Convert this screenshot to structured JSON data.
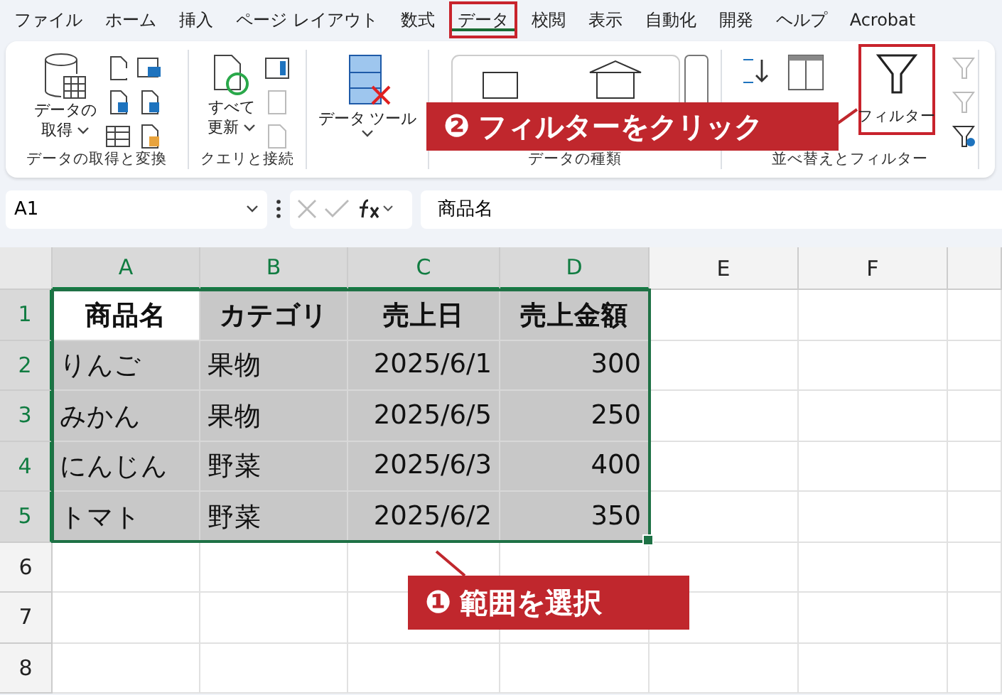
{
  "tabs": [
    {
      "label": "ファイル",
      "selected": false,
      "highlighted": false
    },
    {
      "label": "ホーム",
      "selected": false,
      "highlighted": false
    },
    {
      "label": "挿入",
      "selected": false,
      "highlighted": false
    },
    {
      "label": "ページ レイアウト",
      "selected": false,
      "highlighted": false
    },
    {
      "label": "数式",
      "selected": false,
      "highlighted": false
    },
    {
      "label": "データ",
      "selected": true,
      "highlighted": true
    },
    {
      "label": "校閲",
      "selected": false,
      "highlighted": false
    },
    {
      "label": "表示",
      "selected": false,
      "highlighted": false
    },
    {
      "label": "自動化",
      "selected": false,
      "highlighted": false
    },
    {
      "label": "開発",
      "selected": false,
      "highlighted": false
    },
    {
      "label": "ヘルプ",
      "selected": false,
      "highlighted": false
    },
    {
      "label": "Acrobat",
      "selected": false,
      "highlighted": false
    }
  ],
  "ribbon": {
    "get_data": {
      "group_label": "データの取得と変換",
      "button_lines": [
        "データの",
        "取得"
      ]
    },
    "queries": {
      "group_label": "クエリと接続",
      "button_lines": [
        "すべて",
        "更新"
      ]
    },
    "data_tools": {
      "button": "データ ツール"
    },
    "data_types": {
      "group_label": "データの種類"
    },
    "sort_filter": {
      "group_label": "並べ替えとフィルター",
      "filter_button": {
        "label": "フィルター",
        "highlighted": true
      }
    }
  },
  "formula_bar": {
    "name_box": "A1",
    "formula": "商品名"
  },
  "sheet": {
    "columns": [
      {
        "label": "A",
        "selected": true
      },
      {
        "label": "B",
        "selected": true
      },
      {
        "label": "C",
        "selected": true
      },
      {
        "label": "D",
        "selected": true
      },
      {
        "label": "E",
        "selected": false
      },
      {
        "label": "F",
        "selected": false
      }
    ],
    "rows": [
      {
        "number": "1",
        "selected": true,
        "cells": [
          {
            "text": "商品名",
            "kind": "header",
            "selected": true,
            "active": true
          },
          {
            "text": "カテゴリ",
            "kind": "header",
            "selected": true,
            "active": false
          },
          {
            "text": "売上日",
            "kind": "header",
            "selected": true,
            "active": false
          },
          {
            "text": "売上金額",
            "kind": "header",
            "selected": true,
            "active": false
          }
        ]
      },
      {
        "number": "2",
        "selected": true,
        "cells": [
          {
            "text": "りんご",
            "kind": "text",
            "selected": true,
            "active": false
          },
          {
            "text": "果物",
            "kind": "text",
            "selected": true,
            "active": false
          },
          {
            "text": "2025/6/1",
            "kind": "number",
            "selected": true,
            "active": false
          },
          {
            "text": "300",
            "kind": "number",
            "selected": true,
            "active": false
          }
        ]
      },
      {
        "number": "3",
        "selected": true,
        "cells": [
          {
            "text": "みかん",
            "kind": "text",
            "selected": true,
            "active": false
          },
          {
            "text": "果物",
            "kind": "text",
            "selected": true,
            "active": false
          },
          {
            "text": "2025/6/5",
            "kind": "number",
            "selected": true,
            "active": false
          },
          {
            "text": "250",
            "kind": "number",
            "selected": true,
            "active": false
          }
        ]
      },
      {
        "number": "4",
        "selected": true,
        "cells": [
          {
            "text": "にんじん",
            "kind": "text",
            "selected": true,
            "active": false
          },
          {
            "text": "野菜",
            "kind": "text",
            "selected": true,
            "active": false
          },
          {
            "text": "2025/6/3",
            "kind": "number",
            "selected": true,
            "active": false
          },
          {
            "text": "400",
            "kind": "number",
            "selected": true,
            "active": false
          }
        ]
      },
      {
        "number": "5",
        "selected": true,
        "cells": [
          {
            "text": "トマト",
            "kind": "text",
            "selected": true,
            "active": false
          },
          {
            "text": "野菜",
            "kind": "text",
            "selected": true,
            "active": false
          },
          {
            "text": "2025/6/2",
            "kind": "number",
            "selected": true,
            "active": false
          },
          {
            "text": "350",
            "kind": "number",
            "selected": true,
            "active": false
          }
        ]
      },
      {
        "number": "6",
        "selected": false,
        "cells": []
      },
      {
        "number": "7",
        "selected": false,
        "cells": []
      },
      {
        "number": "8",
        "selected": false,
        "cells": []
      }
    ]
  },
  "callouts": [
    {
      "number": "❷",
      "text": "フィルターをクリック"
    },
    {
      "number": "❶",
      "text": "範囲を選択"
    }
  ]
}
